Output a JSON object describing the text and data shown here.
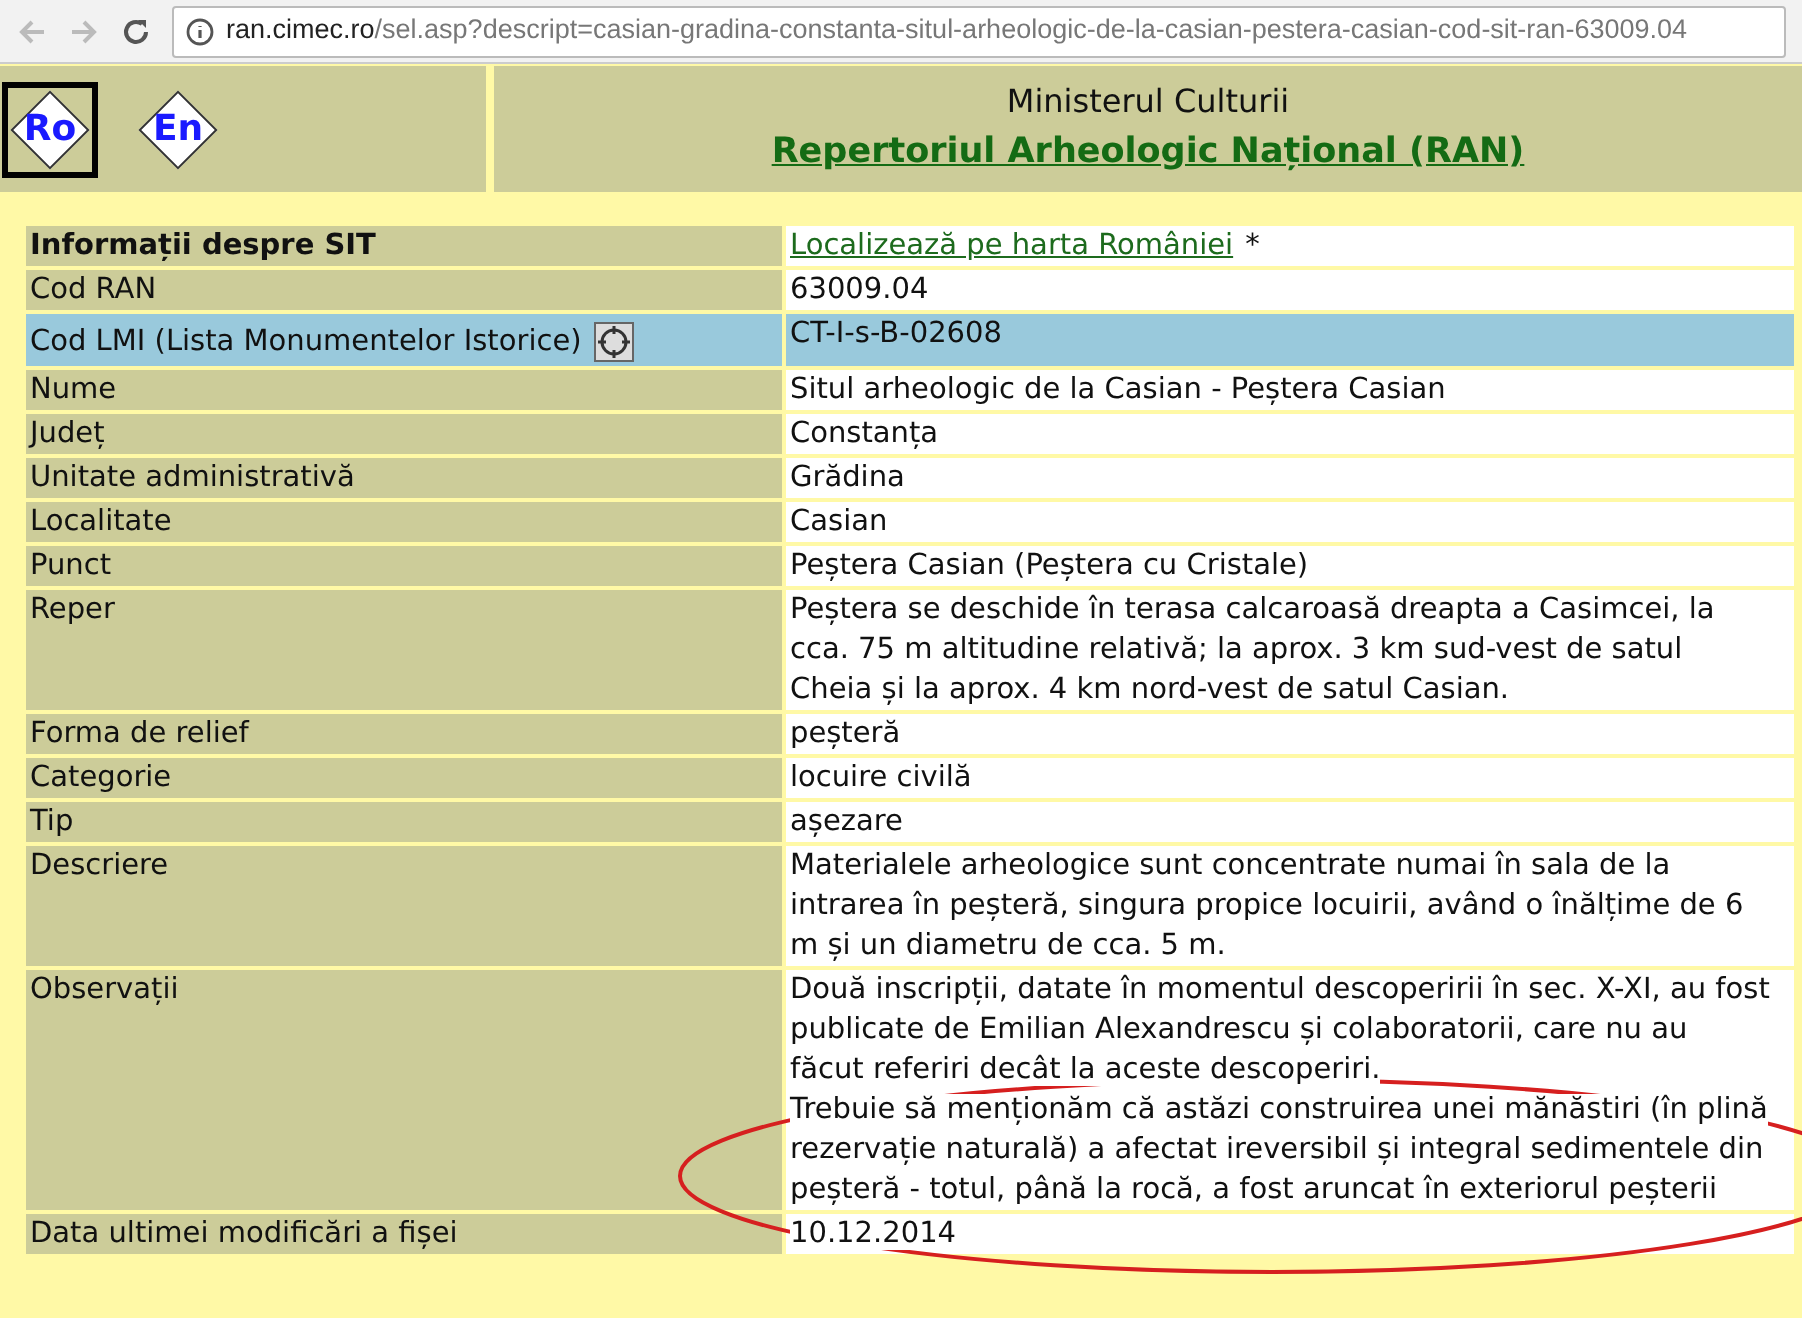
{
  "browser": {
    "url_host": "ran.cimec.ro",
    "url_path": "/sel.asp?descript=casian-gradina-constanta-situl-arheologic-de-la-casian-pestera-casian-cod-sit-ran-63009.04"
  },
  "header": {
    "languages": [
      {
        "label": "Ro",
        "selected": true
      },
      {
        "label": "En",
        "selected": false
      }
    ],
    "ministry": "Ministerul Culturii",
    "title": "Repertoriul Arheologic Național (RAN)"
  },
  "rows": [
    {
      "kind": "heading",
      "label": "Informații despre SIT",
      "link": "Localizează pe harta României",
      "value": [
        "*"
      ]
    },
    {
      "kind": "plain",
      "label": "Cod RAN",
      "value": [
        "63009.04"
      ]
    },
    {
      "kind": "highlight",
      "label": "Cod LMI (Lista Monumentelor Istorice)",
      "value": [
        "CT-I-s-B-02608"
      ]
    },
    {
      "kind": "plain",
      "label": "Nume",
      "value": [
        "Situl arheologic de la Casian - Peștera Casian"
      ]
    },
    {
      "kind": "plain",
      "label": "Județ",
      "value": [
        "Constanța"
      ]
    },
    {
      "kind": "plain",
      "label": "Unitate administrativă",
      "value": [
        "Grădina"
      ]
    },
    {
      "kind": "plain",
      "label": "Localitate",
      "value": [
        "Casian"
      ]
    },
    {
      "kind": "plain",
      "label": "Punct",
      "value": [
        "Peștera Casian (Peștera cu Cristale)"
      ]
    },
    {
      "kind": "plain",
      "label": "Reper",
      "value": [
        "Peștera se deschide în terasa calcaroasă dreapta a Casimcei, la cca. 75 m altitudine relativă; la aprox. 3 km sud-vest de satul Cheia și la aprox. 4 km nord-vest de satul Casian."
      ]
    },
    {
      "kind": "plain",
      "label": "Forma de relief",
      "value": [
        "peșteră"
      ]
    },
    {
      "kind": "plain",
      "label": "Categorie",
      "value": [
        "locuire civilă"
      ]
    },
    {
      "kind": "plain",
      "label": "Tip",
      "value": [
        "așezare"
      ]
    },
    {
      "kind": "plain",
      "label": "Descriere",
      "value": [
        "Materialele arheologice sunt concentrate numai în sala de la intrarea în peșteră, singura propice locuirii, având o înălțime de 6 m și un diametru de cca. 5 m."
      ]
    },
    {
      "kind": "plain",
      "label": "Observații",
      "value": [
        "Două inscripții, datate în momentul descoperirii în sec. X-XI, au fost publicate de Emilian Alexandrescu și colaboratorii, care nu au făcut referiri decât la aceste descoperiri.",
        "Trebuie să menționăm că astăzi construirea unei mănăstiri (în plină rezervație naturală) a afectat ireversibil și integral sedimentele din peșteră - totul, până la rocă, a fost aruncat în exteriorul peșterii"
      ]
    },
    {
      "kind": "plain",
      "label": "Data ultimei modificări a fișei",
      "value": [
        "10.12.2014"
      ]
    }
  ]
}
